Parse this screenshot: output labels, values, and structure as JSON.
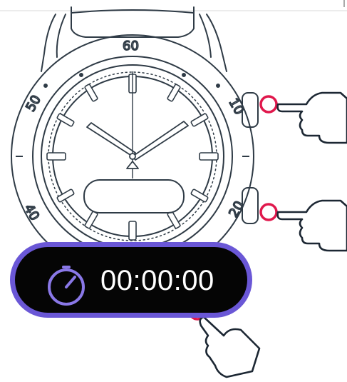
{
  "timer": {
    "display": "00:00:00",
    "icon": "stopwatch-icon"
  },
  "bezel": {
    "labels": [
      "60",
      "10",
      "20",
      "40",
      "50"
    ]
  },
  "colors": {
    "press_indicator": "#e0184c",
    "timer_border": "#6a57d6",
    "timer_background": "#050505",
    "outline": "#2f3b46"
  }
}
